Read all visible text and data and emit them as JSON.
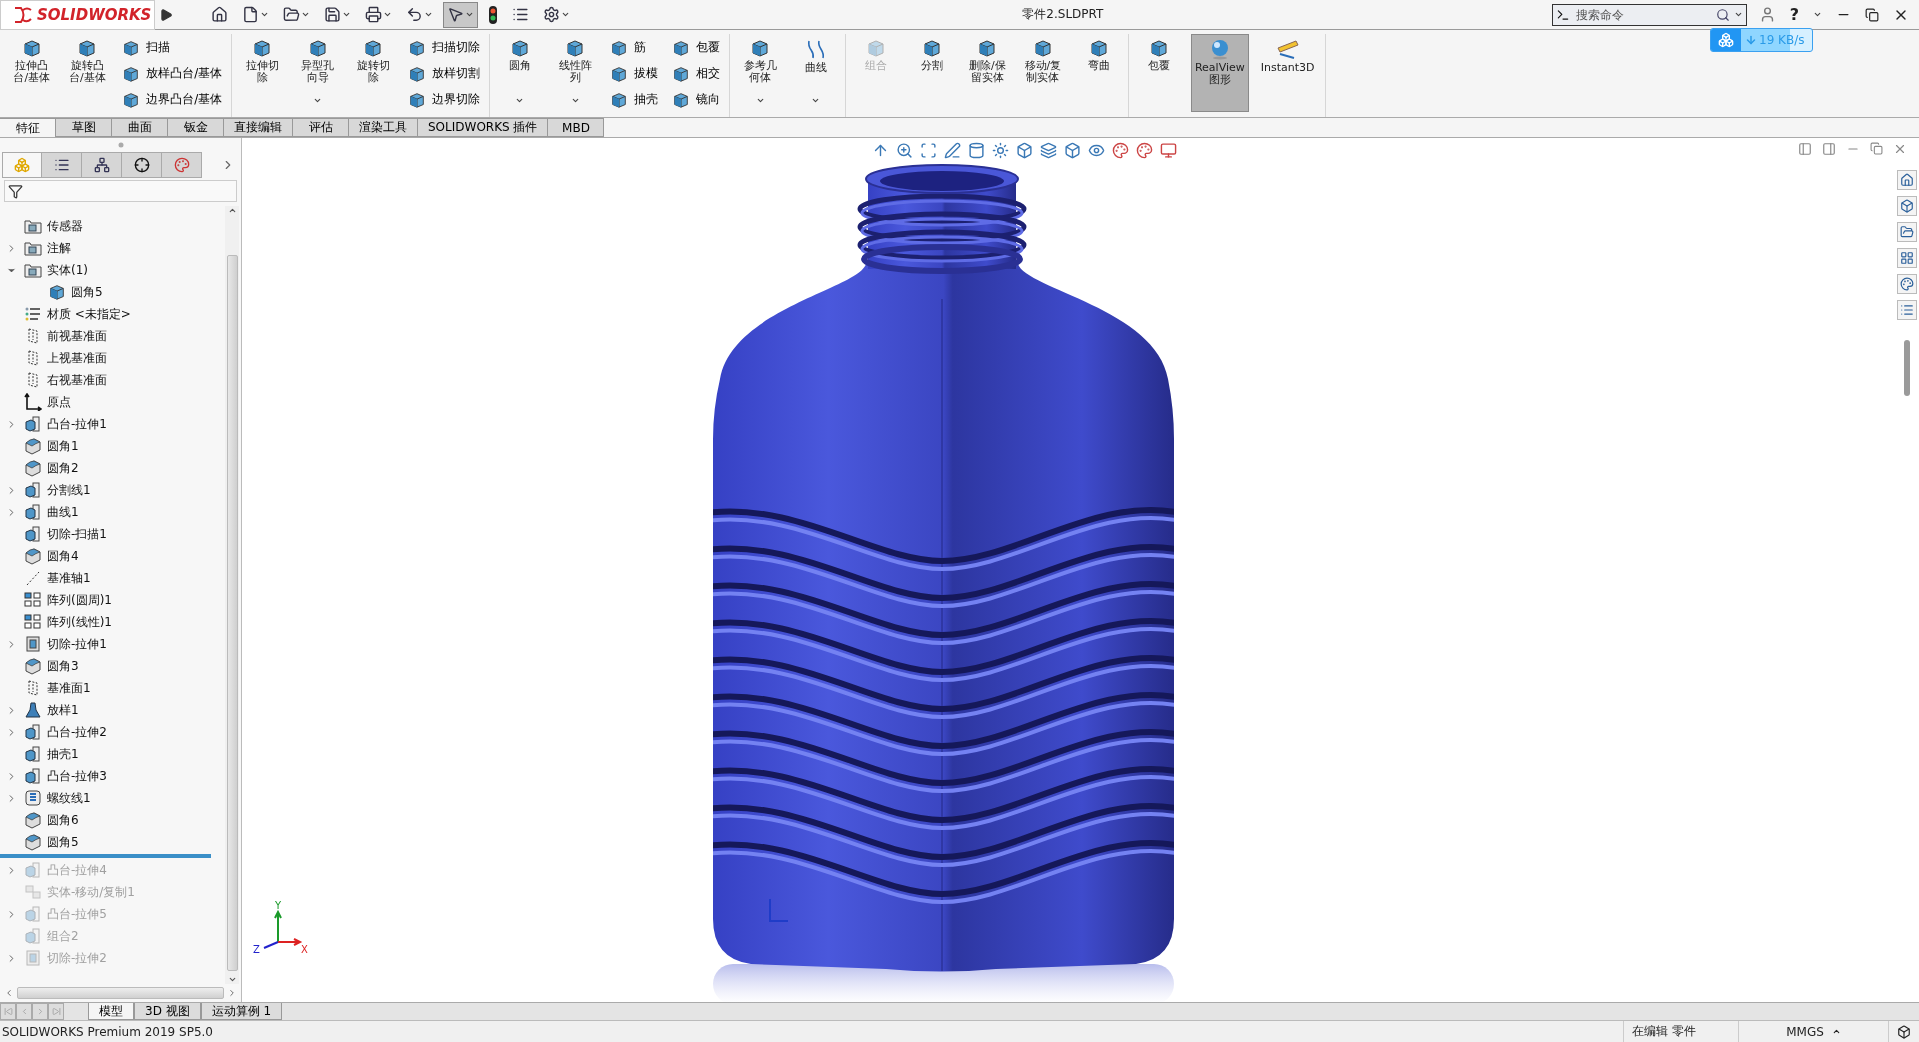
{
  "title_bar": {
    "logo": "SOLIDWORKS",
    "document": "零件2.SLDPRT",
    "search": {
      "placeholder": "搜索命令"
    },
    "help": "?"
  },
  "quick_access": [
    {
      "selected": false,
      "dropdown": false
    },
    {
      "selected": false,
      "dropdown": true
    },
    {
      "selected": false,
      "dropdown": true
    },
    {
      "selected": false,
      "dropdown": true
    },
    {
      "selected": false,
      "dropdown": true
    },
    {
      "selected": false,
      "dropdown": true
    },
    {
      "selected": true,
      "dropdown": true
    },
    {
      "selected": false,
      "dropdown": false
    },
    {
      "selected": false,
      "dropdown": false
    },
    {
      "selected": false,
      "dropdown": true
    }
  ],
  "download_badge": {
    "speed": "19 KB/s"
  },
  "ribbon": {
    "groups": [
      {
        "columns": [
          {
            "kind": "large",
            "label": "拉伸凸台/基体",
            "dropdown": false,
            "disabled": false,
            "selected": false
          },
          {
            "kind": "large",
            "label": "旋转凸台/基体",
            "dropdown": false,
            "disabled": false,
            "selected": false
          },
          {
            "kind": "stack",
            "items": [
              {
                "label": "扫描"
              },
              {
                "label": "放样凸台/基体"
              },
              {
                "label": "边界凸台/基体"
              }
            ]
          }
        ]
      },
      {
        "columns": [
          {
            "kind": "large",
            "label": "拉伸切除",
            "dropdown": false,
            "disabled": false,
            "selected": false
          },
          {
            "kind": "large",
            "label": "异型孔向导",
            "dropdown": true,
            "disabled": false,
            "selected": false
          },
          {
            "kind": "large",
            "label": "旋转切除",
            "dropdown": false,
            "disabled": false,
            "selected": false
          },
          {
            "kind": "stack",
            "items": [
              {
                "label": "扫描切除"
              },
              {
                "label": "放样切割"
              },
              {
                "label": "边界切除"
              }
            ]
          }
        ]
      },
      {
        "columns": [
          {
            "kind": "large",
            "label": "圆角",
            "dropdown": true,
            "disabled": false,
            "selected": false
          },
          {
            "kind": "large",
            "label": "线性阵列",
            "dropdown": true,
            "disabled": false,
            "selected": false
          },
          {
            "kind": "stack",
            "items": [
              {
                "label": "筋"
              },
              {
                "label": "拔模"
              },
              {
                "label": "抽壳"
              }
            ]
          },
          {
            "kind": "stack",
            "items": [
              {
                "label": "包覆"
              },
              {
                "label": "相交"
              },
              {
                "label": "镜向"
              }
            ]
          }
        ]
      },
      {
        "columns": [
          {
            "kind": "large",
            "label": "参考几何体",
            "dropdown": true,
            "disabled": false,
            "selected": false
          },
          {
            "kind": "large",
            "label": "曲线",
            "dropdown": true,
            "disabled": false,
            "selected": false
          }
        ]
      },
      {
        "columns": [
          {
            "kind": "large",
            "label": "组合",
            "dropdown": false,
            "disabled": true,
            "selected": false
          },
          {
            "kind": "large",
            "label": "分割",
            "dropdown": false,
            "disabled": false,
            "selected": false
          },
          {
            "kind": "large",
            "label": "删除/保留实体",
            "dropdown": false,
            "disabled": false,
            "selected": false
          },
          {
            "kind": "large",
            "label": "移动/复制实体",
            "dropdown": false,
            "disabled": false,
            "selected": false
          },
          {
            "kind": "large",
            "label": "弯曲",
            "dropdown": false,
            "disabled": false,
            "selected": false
          }
        ]
      },
      {
        "columns": [
          {
            "kind": "large",
            "label": "包覆",
            "dropdown": false,
            "disabled": false,
            "selected": false
          },
          {
            "kind": "large",
            "label": "RealView 图形",
            "dropdown": false,
            "disabled": false,
            "selected": true
          },
          {
            "kind": "large",
            "label": "Instant3D",
            "dropdown": false,
            "disabled": false,
            "selected": false
          }
        ]
      }
    ]
  },
  "command_tabs": [
    {
      "label": "特征",
      "selected": true
    },
    {
      "label": "草图",
      "selected": false
    },
    {
      "label": "曲面",
      "selected": false
    },
    {
      "label": "钣金",
      "selected": false
    },
    {
      "label": "直接编辑",
      "selected": false
    },
    {
      "label": "评估",
      "selected": false
    },
    {
      "label": "渲染工具",
      "selected": false
    },
    {
      "label": "SOLIDWORKS 插件",
      "selected": false
    },
    {
      "label": "MBD",
      "selected": false
    }
  ],
  "feature_manager": {
    "tabs": [
      {
        "selected": true
      },
      {
        "selected": false
      },
      {
        "selected": false
      },
      {
        "selected": false
      },
      {
        "selected": false
      }
    ],
    "tree": [
      {
        "kind": "feature",
        "label": "传感器",
        "expandable": false,
        "suppressed": false
      },
      {
        "kind": "feature",
        "label": "注解",
        "expandable": true,
        "expanded": false,
        "suppressed": false
      },
      {
        "kind": "feature",
        "label": "实体(1)",
        "expandable": true,
        "expanded": true,
        "suppressed": false,
        "children": [
          {
            "kind": "feature",
            "label": "圆角5",
            "expandable": false,
            "suppressed": false
          }
        ]
      },
      {
        "kind": "feature",
        "label": "材质 <未指定>",
        "expandable": false,
        "suppressed": false
      },
      {
        "kind": "feature",
        "label": "前视基准面",
        "expandable": false,
        "suppressed": false
      },
      {
        "kind": "feature",
        "label": "上视基准面",
        "expandable": false,
        "suppressed": false
      },
      {
        "kind": "feature",
        "label": "右视基准面",
        "expandable": false,
        "suppressed": false
      },
      {
        "kind": "feature",
        "label": "原点",
        "expandable": false,
        "suppressed": false
      },
      {
        "kind": "feature",
        "label": "凸台-拉伸1",
        "expandable": true,
        "expanded": false,
        "suppressed": false
      },
      {
        "kind": "feature",
        "label": "圆角1",
        "expandable": false,
        "suppressed": false
      },
      {
        "kind": "feature",
        "label": "圆角2",
        "expandable": false,
        "suppressed": false
      },
      {
        "kind": "feature",
        "label": "分割线1",
        "expandable": true,
        "expanded": false,
        "suppressed": false
      },
      {
        "kind": "feature",
        "label": "曲线1",
        "expandable": true,
        "expanded": false,
        "suppressed": false
      },
      {
        "kind": "feature",
        "label": "切除-扫描1",
        "expandable": false,
        "suppressed": false
      },
      {
        "kind": "feature",
        "label": "圆角4",
        "expandable": false,
        "suppressed": false
      },
      {
        "kind": "feature",
        "label": "基准轴1",
        "expandable": false,
        "suppressed": false
      },
      {
        "kind": "feature",
        "label": "阵列(圆周)1",
        "expandable": false,
        "suppressed": false
      },
      {
        "kind": "feature",
        "label": "阵列(线性)1",
        "expandable": false,
        "suppressed": false
      },
      {
        "kind": "feature",
        "label": "切除-拉伸1",
        "expandable": true,
        "expanded": false,
        "suppressed": false
      },
      {
        "kind": "feature",
        "label": "圆角3",
        "expandable": false,
        "suppressed": false
      },
      {
        "kind": "feature",
        "label": "基准面1",
        "expandable": false,
        "suppressed": false
      },
      {
        "kind": "feature",
        "label": "放样1",
        "expandable": true,
        "expanded": false,
        "suppressed": false
      },
      {
        "kind": "feature",
        "label": "凸台-拉伸2",
        "expandable": true,
        "expanded": false,
        "suppressed": false
      },
      {
        "kind": "feature",
        "label": "抽壳1",
        "expandable": false,
        "suppressed": false
      },
      {
        "kind": "feature",
        "label": "凸台-拉伸3",
        "expandable": true,
        "expanded": false,
        "suppressed": false
      },
      {
        "kind": "feature",
        "label": "螺纹线1",
        "expandable": true,
        "expanded": false,
        "suppressed": false
      },
      {
        "kind": "feature",
        "label": "圆角6",
        "expandable": false,
        "suppressed": false
      },
      {
        "kind": "feature",
        "label": "圆角5",
        "expandable": false,
        "suppressed": false
      },
      {
        "kind": "rollback"
      },
      {
        "kind": "feature",
        "label": "凸台-拉伸4",
        "expandable": true,
        "expanded": false,
        "suppressed": true
      },
      {
        "kind": "feature",
        "label": "实体-移动/复制1",
        "expandable": false,
        "suppressed": true
      },
      {
        "kind": "feature",
        "label": "凸台-拉伸5",
        "expandable": true,
        "expanded": false,
        "suppressed": true
      },
      {
        "kind": "feature",
        "label": "组合2",
        "expandable": false,
        "suppressed": true
      },
      {
        "kind": "feature",
        "label": "切除-拉伸2",
        "expandable": true,
        "expanded": false,
        "suppressed": true
      }
    ]
  },
  "viewport": {
    "triad": {
      "x": "X",
      "y": "Y",
      "z": "Z"
    }
  },
  "model_tabs": [
    {
      "label": "模型",
      "selected": true
    },
    {
      "label": "3D 视图",
      "selected": false
    },
    {
      "label": "运动算例 1",
      "selected": false
    }
  ],
  "status_bar": {
    "product": "SOLIDWORKS Premium 2019 SP5.0",
    "mode": "在编辑 零件",
    "units": "MMGS"
  }
}
